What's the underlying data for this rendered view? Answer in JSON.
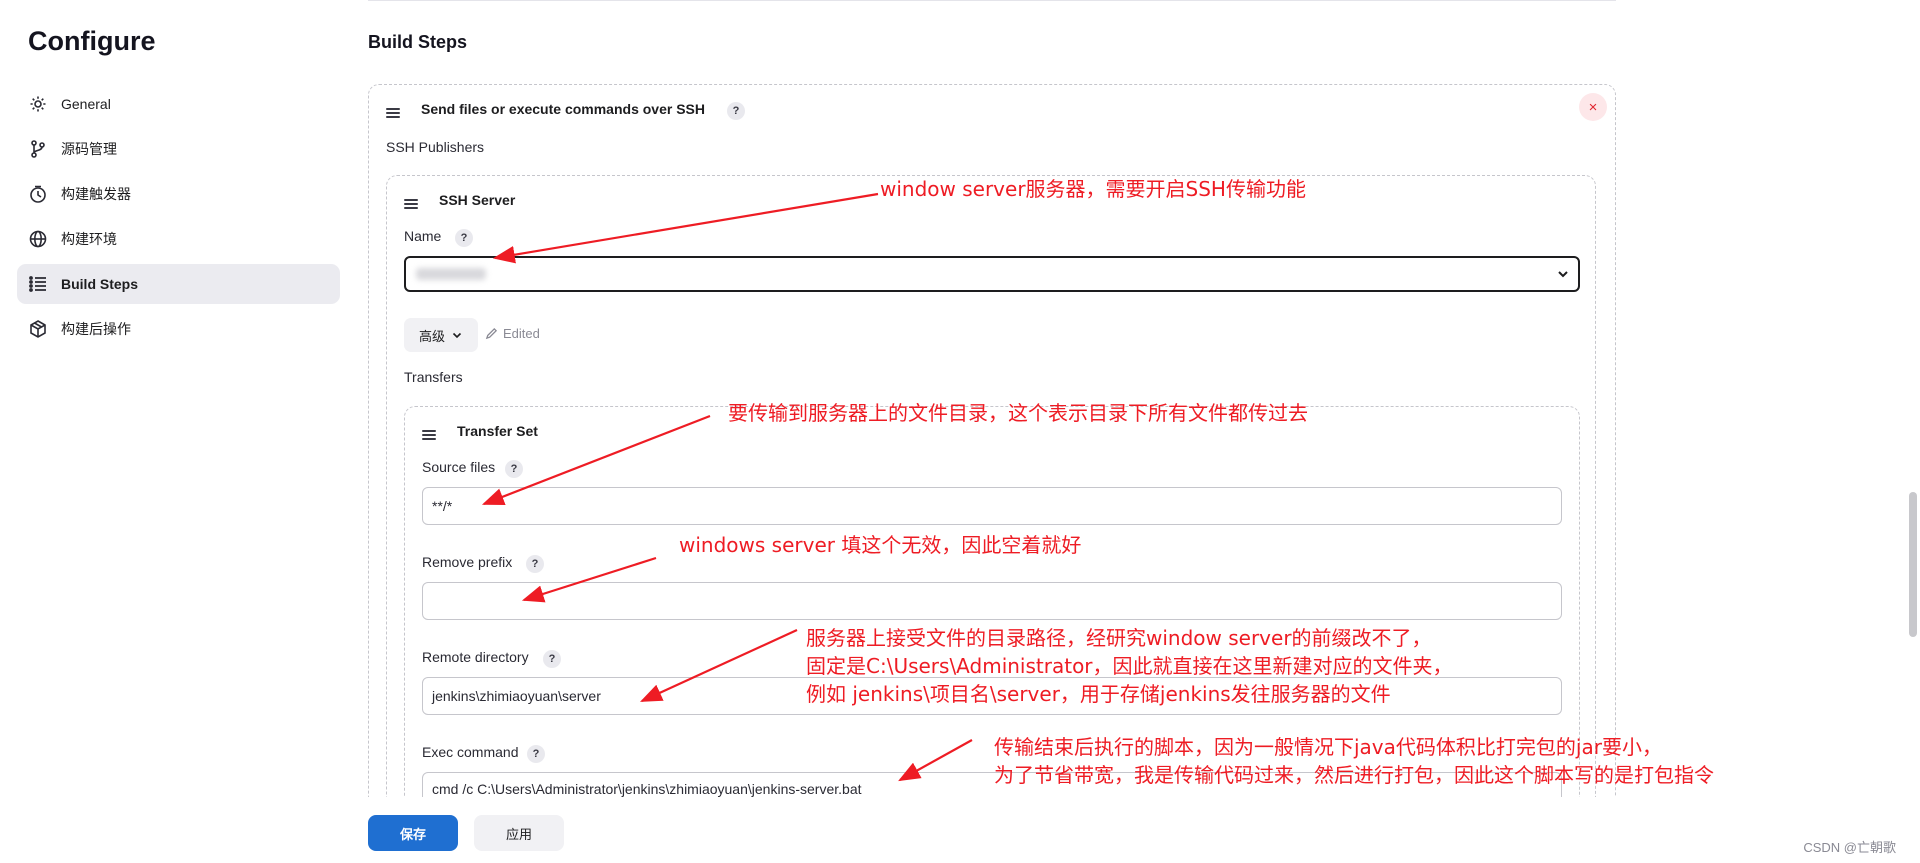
{
  "sidebar": {
    "title": "Configure",
    "items": [
      {
        "label": "General",
        "icon": "gear-icon"
      },
      {
        "label": "源码管理",
        "icon": "branch-icon"
      },
      {
        "label": "构建触发器",
        "icon": "clock-icon"
      },
      {
        "label": "构建环境",
        "icon": "globe-icon"
      },
      {
        "label": "Build Steps",
        "icon": "list-icon",
        "active": true
      },
      {
        "label": "构建后操作",
        "icon": "package-icon"
      }
    ]
  },
  "main": {
    "section_title": "Build Steps",
    "builder": {
      "title": "Send files or execute commands over SSH",
      "help": "?",
      "close": "×",
      "publishers_label": "SSH Publishers",
      "server": {
        "title": "SSH Server",
        "name_label": "Name",
        "help": "?",
        "advanced_label": "高级",
        "edited_label": "Edited",
        "transfers_label": "Transfers",
        "transfer_set": {
          "title": "Transfer Set",
          "source_files_label": "Source files",
          "source_files_value": "**/*",
          "remove_prefix_label": "Remove prefix",
          "remove_prefix_value": "",
          "remote_directory_label": "Remote directory",
          "remote_directory_value": "jenkins\\zhimiaoyuan\\server",
          "exec_command_label": "Exec command",
          "exec_command_value": "cmd /c C:\\Users\\Administrator\\jenkins\\zhimiaoyuan\\jenkins-server.bat"
        }
      }
    }
  },
  "footer": {
    "save_label": "保存",
    "apply_label": "应用",
    "watermark": "CSDN @亡朝歌"
  },
  "annotations": {
    "a1": "window server服务器，需要开启SSH传输功能",
    "a2": "要传输到服务器上的文件目录，这个表示目录下所有文件都传过去",
    "a3": "windows server 填这个无效，因此空着就好",
    "a4_line1": "服务器上接受文件的目录路径，经研究window server的前缀改不了，",
    "a4_line2": "固定是C:\\Users\\Administrator，因此就直接在这里新建对应的文件夹，",
    "a4_line3": "例如 jenkins\\项目名\\server，用于存储jenkins发往服务器的文件",
    "a5_line1": "传输结束后执行的脚本，因为一般情况下java代码体积比打完包的jar要小，",
    "a5_line2": "为了节省带宽，我是传输代码过来，然后进行打包，因此这个脚本写的是打包指令"
  },
  "colors": {
    "accent": "#1f6fd1",
    "annotation": "#ee1c24",
    "active_nav_bg": "#ebebf0"
  }
}
